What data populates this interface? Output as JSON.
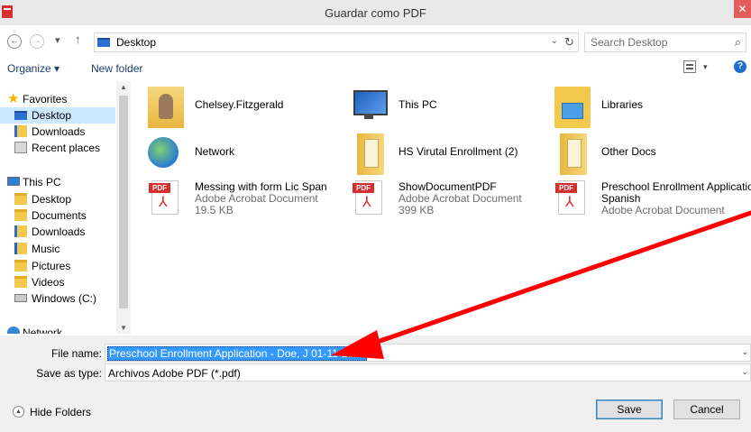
{
  "window": {
    "title": "Guardar como PDF",
    "close_glyph": "✕"
  },
  "nav": {
    "back_glyph": "←",
    "forward_glyph": "→",
    "recent_glyph": "▾",
    "up_glyph": "↑",
    "address": "Desktop",
    "address_dropdown_glyph": "⌄",
    "refresh_glyph": "↻",
    "search_placeholder": "Search Desktop",
    "search_glyph": "⌕"
  },
  "toolbar": {
    "organize": "Organize ▾",
    "new_folder": "New folder",
    "views_dropdown": "▾",
    "help_glyph": "?"
  },
  "sidebar": {
    "favorites": [
      {
        "label": "Favorites",
        "icon": "star-icon"
      },
      {
        "label": "Desktop",
        "icon": "desktop-icon",
        "selected": true
      },
      {
        "label": "Downloads",
        "icon": "downloads-icon"
      },
      {
        "label": "Recent places",
        "icon": "recent-places-icon"
      }
    ],
    "thispc": [
      {
        "label": "This PC",
        "icon": "computer-icon"
      },
      {
        "label": "Desktop",
        "icon": "desktop-icon"
      },
      {
        "label": "Documents",
        "icon": "folder-icon"
      },
      {
        "label": "Downloads",
        "icon": "downloads-icon"
      },
      {
        "label": "Music",
        "icon": "music-icon"
      },
      {
        "label": "Pictures",
        "icon": "folder-icon"
      },
      {
        "label": "Videos",
        "icon": "folder-icon"
      },
      {
        "label": "Windows (C:)",
        "icon": "drive-icon"
      }
    ],
    "network": {
      "label": "Network",
      "icon": "network-icon"
    },
    "scroll_up": "▲",
    "scroll_down": "▼"
  },
  "files": [
    {
      "name": "Chelsey.Fitzgerald",
      "icon": "user-folder-icon"
    },
    {
      "name": "This PC",
      "icon": "computer-icon"
    },
    {
      "name": "Libraries",
      "icon": "libraries-icon"
    },
    {
      "name": "Network",
      "icon": "network-icon"
    },
    {
      "name": "HS Virutal Enrollment (2)",
      "icon": "folder-icon"
    },
    {
      "name": "Other Docs",
      "icon": "folder-icon"
    },
    {
      "name": "Messing with form Lic Span",
      "type": "Adobe Acrobat Document",
      "size": "19.5 KB",
      "icon": "pdf-icon"
    },
    {
      "name": "ShowDocumentPDF",
      "type": "Adobe Acrobat Document",
      "size": "399 KB",
      "icon": "pdf-icon"
    },
    {
      "name_line1": "Preschool Enrollment Application -",
      "name_line2": "Spanish",
      "type": "Adobe Acrobat Document",
      "icon": "pdf-icon"
    }
  ],
  "pdf_badge": "PDF",
  "pdf_mark": "⅄",
  "form": {
    "filename_label": "File name:",
    "filename_value": "Preschool Enrollment Application - Doe, J 01-11-2011",
    "savetype_label": "Save as type:",
    "savetype_value": "Archivos Adobe PDF (*.pdf)",
    "dropdown_glyph": "⌄"
  },
  "footer": {
    "hide_folders": "Hide Folders",
    "hide_glyph": "▲",
    "save": "Save",
    "cancel": "Cancel"
  },
  "annotation": {
    "color": "#ff0000"
  }
}
